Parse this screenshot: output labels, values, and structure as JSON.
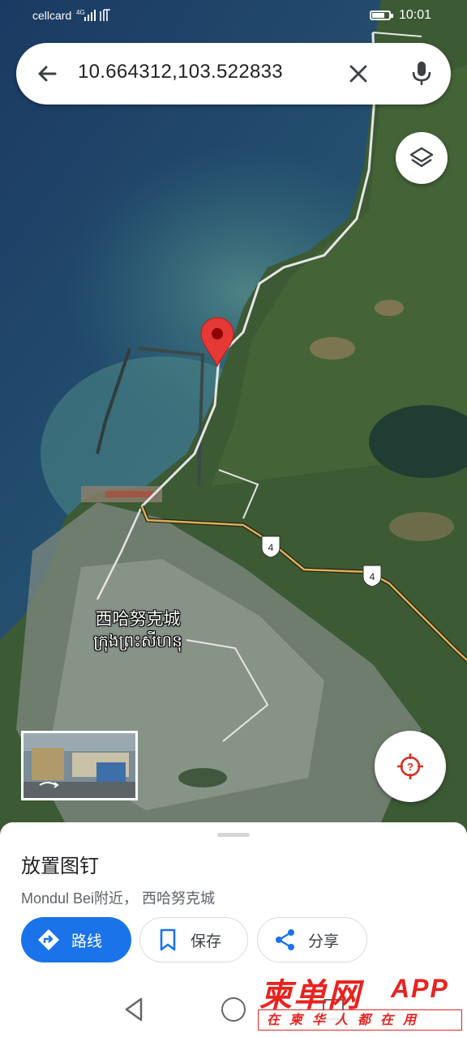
{
  "status_bar": {
    "carrier": "cellcard",
    "network": "4G",
    "time": "10:01"
  },
  "search": {
    "query": "10.664312,103.522833"
  },
  "map": {
    "city_label_zh": "西哈努克城",
    "city_label_km": "ក្រុងព្រះសីហនុ",
    "route_shield_1": "4",
    "route_shield_2": "4",
    "pin_color": "#e53935"
  },
  "place_sheet": {
    "title": "放置图钉",
    "subtitle": "Mondul Bei附近， 西哈努克城",
    "route_label": "路线",
    "save_label": "保存",
    "share_label": "分享"
  },
  "watermark": {
    "brand": "柬单网",
    "app": "APP",
    "slogan": "在柬华人都在用"
  },
  "colors": {
    "accent": "#1a73e8",
    "brand_red": "#e8231f"
  }
}
